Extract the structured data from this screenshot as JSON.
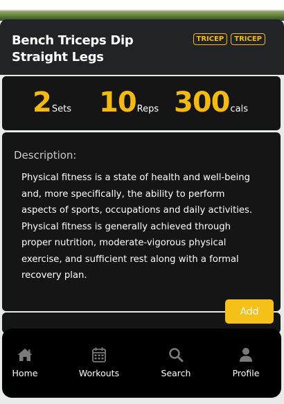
{
  "header": {
    "title": "Bench Triceps Dip Straight Legs",
    "tags": [
      "TRICEP",
      "TRICEP"
    ]
  },
  "stats": {
    "sets": {
      "value": "2",
      "unit": "Sets"
    },
    "reps": {
      "value": "10",
      "unit": "Reps"
    },
    "cals": {
      "value": "300",
      "unit": "cals"
    }
  },
  "description": {
    "label": "Description:",
    "text": "Physical fitness is a state of health and well-being and, more specifically, the ability to perform aspects of sports, occupations and daily activities. Physical fitness is generally achieved through proper nutrition, moderate-vigorous physical exercise, and sufficient rest along with a formal recovery plan."
  },
  "actions": {
    "add_label": "Add"
  },
  "nav": {
    "items": [
      {
        "label": "Home",
        "icon": "home-icon"
      },
      {
        "label": "Workouts",
        "icon": "calendar-icon"
      },
      {
        "label": "Search",
        "icon": "search-icon"
      },
      {
        "label": "Profile",
        "icon": "user-icon"
      }
    ]
  },
  "colors": {
    "accent": "#f5b914",
    "card": "#151515",
    "header": "#222326",
    "nav": "#000000"
  }
}
